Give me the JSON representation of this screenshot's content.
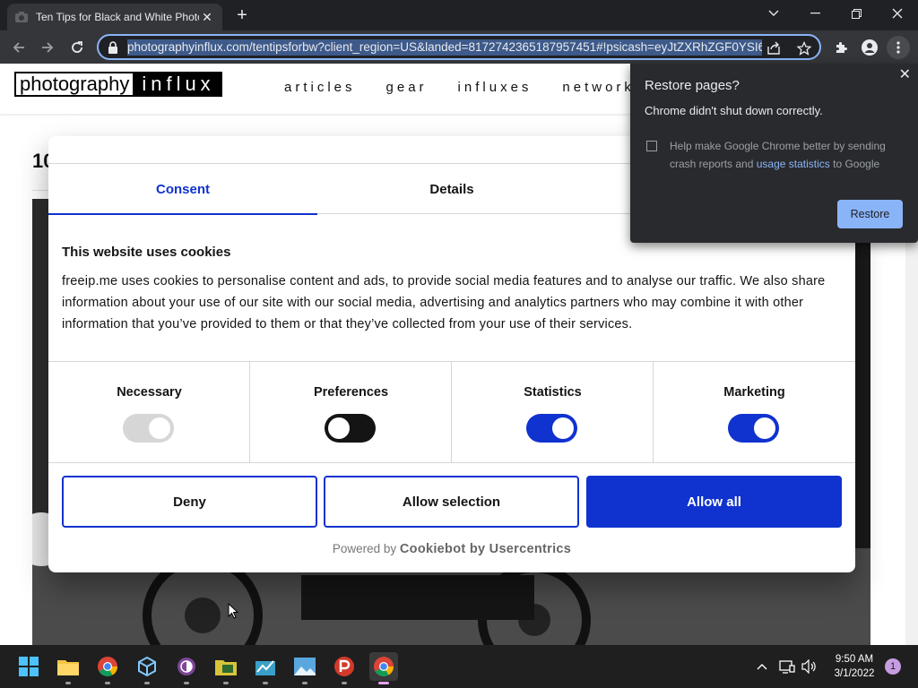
{
  "browser": {
    "tab": {
      "title": "Ten Tips for Black and White Photography",
      "close": "✕"
    },
    "new_tab": "+",
    "url": "photographyinflux.com/tentipsforbw?client_region=US&landed=8172742365187957451#!psicash=eyJtZXRhZGF0YSI6"
  },
  "site": {
    "logo_left": "photography",
    "logo_right": "influx",
    "nav": [
      "articles",
      "gear",
      "influxes",
      "network"
    ],
    "article_title": "10"
  },
  "cookie": {
    "tabs": [
      "Consent",
      "Details",
      ""
    ],
    "heading": "This website uses cookies",
    "body": "freeip.me uses cookies to personalise content and ads, to provide social media features and to analyse our traffic. We also share information about your use of our site with our social media, advertising and analytics partners who may combine it with other information that you’ve provided to them or that they’ve collected from your use of their services.",
    "toggles": [
      {
        "label": "Necessary",
        "state": "on-disabled"
      },
      {
        "label": "Preferences",
        "state": "off"
      },
      {
        "label": "Statistics",
        "state": "on"
      },
      {
        "label": "Marketing",
        "state": "on"
      }
    ],
    "buttons": {
      "deny": "Deny",
      "allow_selection": "Allow selection",
      "allow_all": "Allow all"
    },
    "powered_prefix": "Powered by",
    "powered_brand": "Cookiebot by Usercentrics"
  },
  "restore": {
    "title": "Restore pages?",
    "message": "Chrome didn't shut down correctly.",
    "help_prefix": "Help make Google Chrome better by sending crash reports and",
    "help_link": "usage statistics",
    "help_suffix": "to Google",
    "button": "Restore",
    "close": "✕"
  },
  "taskbar": {
    "time": "9:50 AM",
    "date": "3/1/2022",
    "notifications": "1"
  },
  "colors": {
    "accent": "#1032cf",
    "chrome_dark": "#202124",
    "chrome_blue": "#8ab4f8"
  }
}
